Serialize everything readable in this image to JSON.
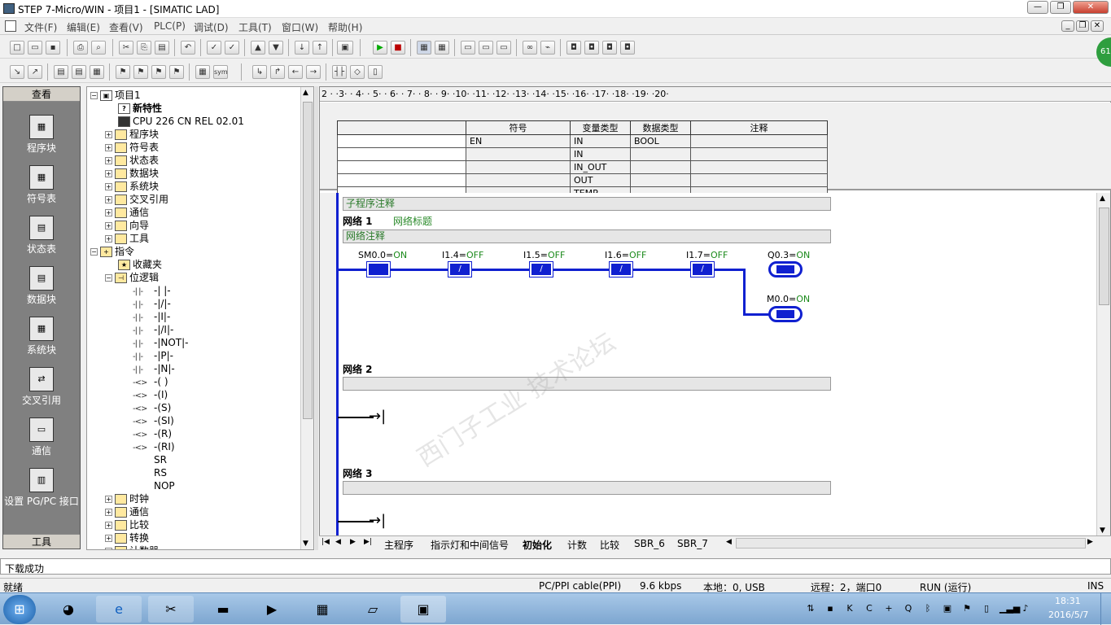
{
  "window": {
    "title": "STEP 7-Micro/WIN - 项目1 - [SIMATIC LAD]"
  },
  "menu": [
    "文件(F)",
    "编辑(E)",
    "查看(V)",
    "PLC(P)",
    "调试(D)",
    "工具(T)",
    "窗口(W)",
    "帮助(H)"
  ],
  "nav": {
    "header": "查看",
    "footer": "工具",
    "items": [
      "程序块",
      "符号表",
      "状态表",
      "数据块",
      "系统块",
      "交叉引用",
      "通信",
      "设置 PG/PC 接口"
    ]
  },
  "tree": {
    "root": "项目1",
    "new": "新特性",
    "cpu": "CPU 226 CN REL 02.01",
    "project_items": [
      "程序块",
      "符号表",
      "状态表",
      "数据块",
      "系统块",
      "交叉引用",
      "通信",
      "向导",
      "工具"
    ],
    "instructions": "指令",
    "favorites": "收藏夹",
    "bitlogic": "位逻辑",
    "bit_items": [
      {
        "sym": "-| |-",
        "label": "-| |-"
      },
      {
        "sym": "-| |-",
        "label": "-|/|-"
      },
      {
        "sym": "-| |-",
        "label": "-|I|-"
      },
      {
        "sym": "-| |-",
        "label": "-|/I|-"
      },
      {
        "sym": "-| |-",
        "label": "-|NOT|-"
      },
      {
        "sym": "-| |-",
        "label": "-|P|-"
      },
      {
        "sym": "-| |-",
        "label": "-|N|-"
      },
      {
        "sym": "-<>",
        "label": "-( )"
      },
      {
        "sym": "-<>",
        "label": "-(I)"
      },
      {
        "sym": "-<>",
        "label": "-(S)"
      },
      {
        "sym": "-<>",
        "label": "-(SI)"
      },
      {
        "sym": "-<>",
        "label": "-(R)"
      },
      {
        "sym": "-<>",
        "label": "-(RI)"
      },
      {
        "sym": "",
        "label": "SR"
      },
      {
        "sym": "",
        "label": "RS"
      },
      {
        "sym": "",
        "label": "NOP"
      }
    ],
    "more": [
      "时钟",
      "通信",
      "比较",
      "转换",
      "计数器"
    ]
  },
  "ruler": "2 · ·3· · 4· · 5· · 6· · 7· · 8· · 9· ·10· ·11· ·12· ·13· ·14· ·15· ·16· ·17· ·18· ·19· ·20·",
  "vartable": {
    "headers": [
      "",
      "符号",
      "变量类型",
      "数据类型",
      "注释"
    ],
    "rows": [
      [
        "",
        "EN",
        "IN",
        "BOOL",
        ""
      ],
      [
        "",
        "",
        "IN",
        "",
        ""
      ],
      [
        "",
        "",
        "IN_OUT",
        "",
        ""
      ],
      [
        "",
        "",
        "OUT",
        "",
        ""
      ],
      [
        "",
        "",
        "TEMP",
        "",
        ""
      ]
    ]
  },
  "ladder": {
    "sub_comment": "子程序注释",
    "net1": {
      "label": "网络 1",
      "title": "网络标题",
      "comment": "网络注释"
    },
    "net2": {
      "label": "网络 2"
    },
    "net3": {
      "label": "网络 3"
    },
    "contacts": [
      {
        "addr": "SM0.0=",
        "state": "ON"
      },
      {
        "addr": "I1.4=",
        "state": "OFF"
      },
      {
        "addr": "I1.5=",
        "state": "OFF"
      },
      {
        "addr": "I1.6=",
        "state": "OFF"
      },
      {
        "addr": "I1.7=",
        "state": "OFF"
      }
    ],
    "coils": [
      {
        "addr": "Q0.3=",
        "state": "ON"
      },
      {
        "addr": "M0.0=",
        "state": "ON"
      }
    ],
    "contact_nc": "/"
  },
  "tabs": [
    "主程序",
    "指示灯和中间信号",
    "初始化",
    "计数",
    "比较",
    "SBR_6",
    "SBR_7"
  ],
  "output": "下载成功",
  "status": {
    "ready": "就绪",
    "cable": "PC/PPI cable(PPI)",
    "baud": "9.6 kbps",
    "local": "本地：0, USB",
    "remote": "远程：2，端口0",
    "mode": "RUN (运行)",
    "ins": "INS"
  },
  "clock": {
    "time": "18:31",
    "date": "2016/5/7"
  },
  "badge": "61",
  "watermark": "西门子工业  技术论坛"
}
